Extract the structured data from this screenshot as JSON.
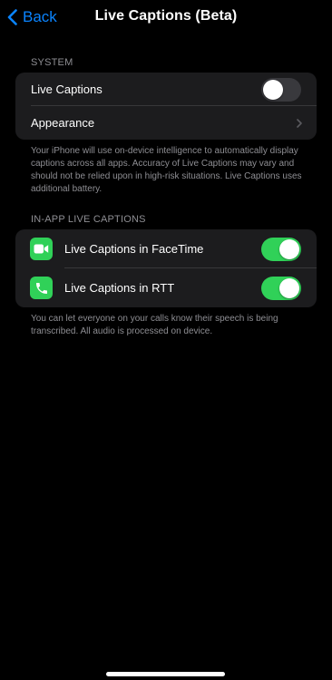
{
  "nav": {
    "back_label": "Back",
    "title": "Live Captions (Beta)"
  },
  "system_section": {
    "header": "SYSTEM",
    "live_captions": {
      "label": "Live Captions",
      "enabled": false
    },
    "appearance": {
      "label": "Appearance"
    },
    "footer": "Your iPhone will use on-device intelligence to automatically display captions across all apps. Accuracy of Live Captions may vary and should not be relied upon in high-risk situations. Live Captions uses additional battery."
  },
  "in_app_section": {
    "header": "IN-APP LIVE CAPTIONS",
    "items": [
      {
        "label": "Live Captions in FaceTime",
        "icon": "facetime-icon",
        "enabled": true
      },
      {
        "label": "Live Captions in RTT",
        "icon": "phone-icon",
        "enabled": true
      }
    ],
    "footer": "You can let everyone on your calls know their speech is being transcribed. All audio is processed on device."
  },
  "colors": {
    "background": "#000000",
    "group_background": "#1c1c1e",
    "accent_blue": "#0a84ff",
    "toggle_on": "#30d158",
    "toggle_off": "#39393d",
    "secondary_text": "#8e8e93"
  }
}
